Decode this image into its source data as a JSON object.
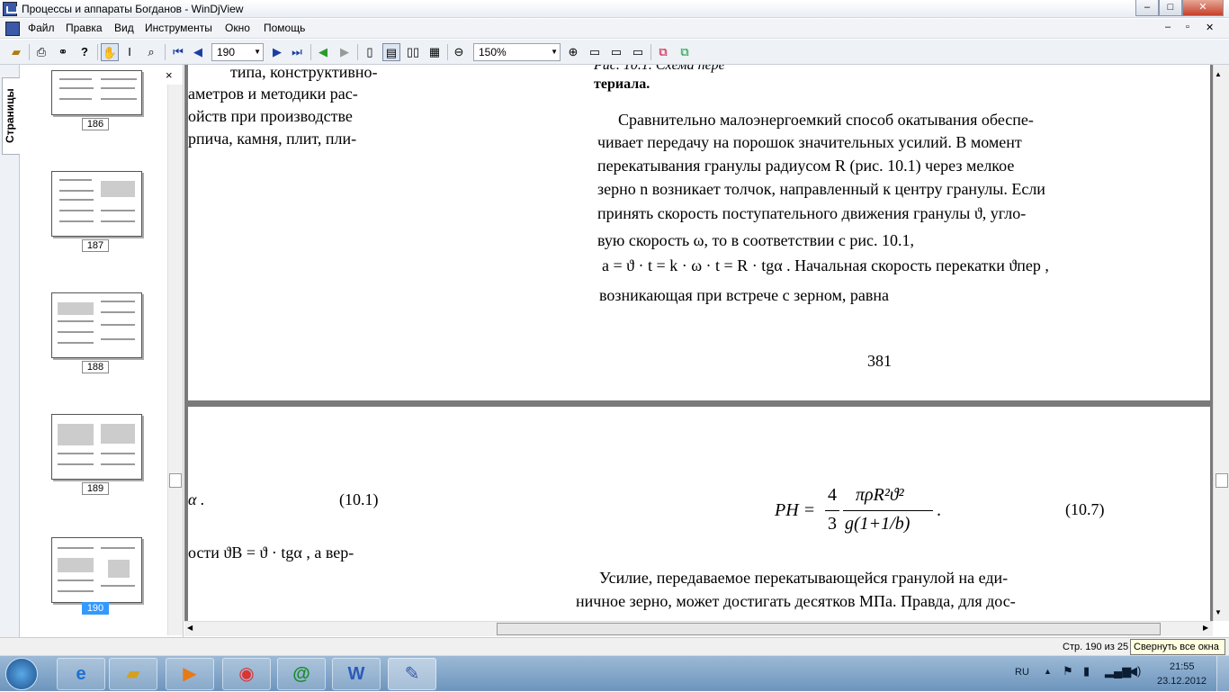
{
  "window": {
    "title": "Процессы и аппараты Богданов - WinDjView",
    "btn_min": "–",
    "btn_max": "□",
    "btn_close": "✕",
    "doc_btn_min": "–",
    "doc_btn_max": "▫",
    "doc_btn_close": "✕"
  },
  "menu": [
    "Файл",
    "Правка",
    "Вид",
    "Инструменты",
    "Окно",
    "Помощь"
  ],
  "toolbar": {
    "page_value": "190",
    "zoom_value": "150%"
  },
  "sidebar": {
    "tab_label": "Страницы",
    "close": "×",
    "thumbnails": [
      "186",
      "187",
      "188",
      "189",
      "190"
    ],
    "selected": "190"
  },
  "page1": {
    "left_lines": [
      "типа,      конструктивно-",
      "аметров и методики рас-",
      "ойств при производстве",
      "рпича, камня, плит, пли-"
    ],
    "caption_top": "Рис. 10.1. Схема пере",
    "caption_end": "териала.",
    "para_lines": [
      "Сравнительно малоэнергоемкий способ окатывания обеспе-",
      "чивает передачу на порошок значительных усилий. В момент",
      "перекатывания гранулы радиусом R (рис. 10.1) через мелкое",
      "зерно n возникает толчок, направленный к центру гранулы. Если",
      "принять скорость поступательного движения гранулы ϑ, угло-",
      "вую      скорость      ω,      то      в      соответствии      с      рис.      10.1,",
      "a = ϑ · t = k · ω · t = R · tgα . Начальная скорость перекатки ϑпер ,",
      "возникающая при встрече с зерном, равна"
    ],
    "page_number": "381"
  },
  "page2": {
    "left_frag1": "α .",
    "left_eq_num": "(10.1)",
    "left_frag2": "ости ϑB = ϑ · tgα , а вер-",
    "formula_lhs": "PH =",
    "formula_frac1_num": "4",
    "formula_frac1_den": "3",
    "formula_frac2_num": "πρR²ϑ²",
    "formula_frac2_den": "g(1+1/b)",
    "formula_end": ".",
    "right_eq_num": "(10.7)",
    "para_lines": [
      "Усилие, передаваемое перекатывающейся гранулой на еди-",
      "ничное зерно, может достигать десятков МПа. Правда, для дос-"
    ]
  },
  "status": {
    "page_info": "Стр. 190 из 25",
    "tooltip": "Свернуть все окна"
  },
  "taskbar": {
    "language": "RU",
    "time": "21:55",
    "date": "23.12.2012"
  }
}
